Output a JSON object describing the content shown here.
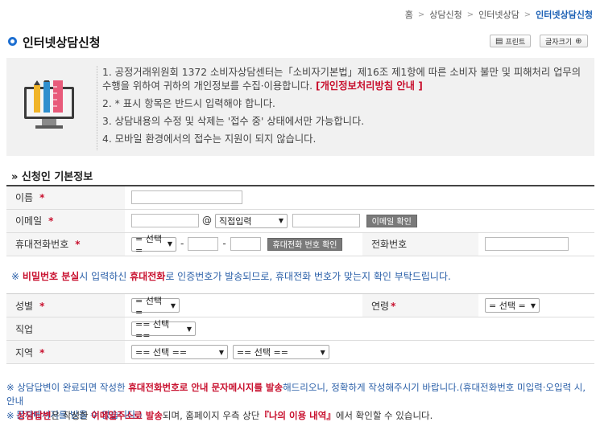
{
  "breadcrumb": {
    "home": "홈",
    "items": [
      "상담신청",
      "인터넷상담"
    ],
    "current": "인터넷상담신청"
  },
  "title": "인터넷상담신청",
  "toolbar": {
    "print": "프린트",
    "fontsize": "글자크기"
  },
  "notice": {
    "line1": "1. 공정거래위원회 1372 소비자상담센터는「소비자기본법」제16조 제1항에 따른 소비자 불만 및 피해처리 업무의 수행을 위하여 귀하의 개인정보를 수집·이용합니다. ",
    "privacy_link": "[개인정보처리방침 안내 ]",
    "line2": "2. * 표시 항목은 반드시 입력해야 합니다.",
    "line3": "3. 상담내용의 수정 및 삭제는 '접수 중' 상태에서만 가능합니다.",
    "line4": "4. 모바일 환경에서의 접수는 지원이 되지 않습니다."
  },
  "section_title": "» 신청인 기본정보",
  "form": {
    "name_label": "이름",
    "email_label": "이메일",
    "email_domain_select": "직접입력",
    "email_check_btn": "이메일 확인",
    "mobile_label": "휴대전화번호",
    "mobile_select": "= 선택 =",
    "mobile_check_btn": "휴대전화 번호 확인",
    "phone_label": "전화번호",
    "required_mark": "*",
    "at_sign": "@",
    "dash": "-"
  },
  "info1": {
    "prefix": "※ ",
    "red1": "비밀번호 분실",
    "mid1": "시 입력하신 ",
    "red2": "휴대전화",
    "rest": "로 인증번호가 발송되므로, 휴대전화 번호가 맞는지 확인 부탁드립니다."
  },
  "form2": {
    "gender_label": "성별",
    "gender_select": "= 선택 =",
    "age_label": "연령",
    "age_select": "= 선택 =",
    "job_label": "직업",
    "job_select": "== 선택 ==",
    "region_label": "지역",
    "region_select1": "== 선택 ==",
    "region_select2": "== 선택 =="
  },
  "bottom": {
    "n1_prefix": "※ 상담답변이 완료되면 작성한 ",
    "n1_red": "휴대전화번호로 안내 문자메시지를 발송",
    "n1_rest": "해드리오니, 정확하게 작성해주시기 바랍니다.(휴대전화번호 미입력·오입력 시, 안내",
    "n1_line2": "문자메시지를 받을 수 없습니다.)",
    "n2_prefix": "※ ",
    "n2_red1": "상담답변",
    "n2_mid": "은 작성한 ",
    "n2_red2": "이메일주소로 발송",
    "n2_mid2": "되며, 홈페이지 우측 상단",
    "n2_red3": "『나의 이용 내역』",
    "n2_rest": "에서 확인할 수 있습니다."
  }
}
